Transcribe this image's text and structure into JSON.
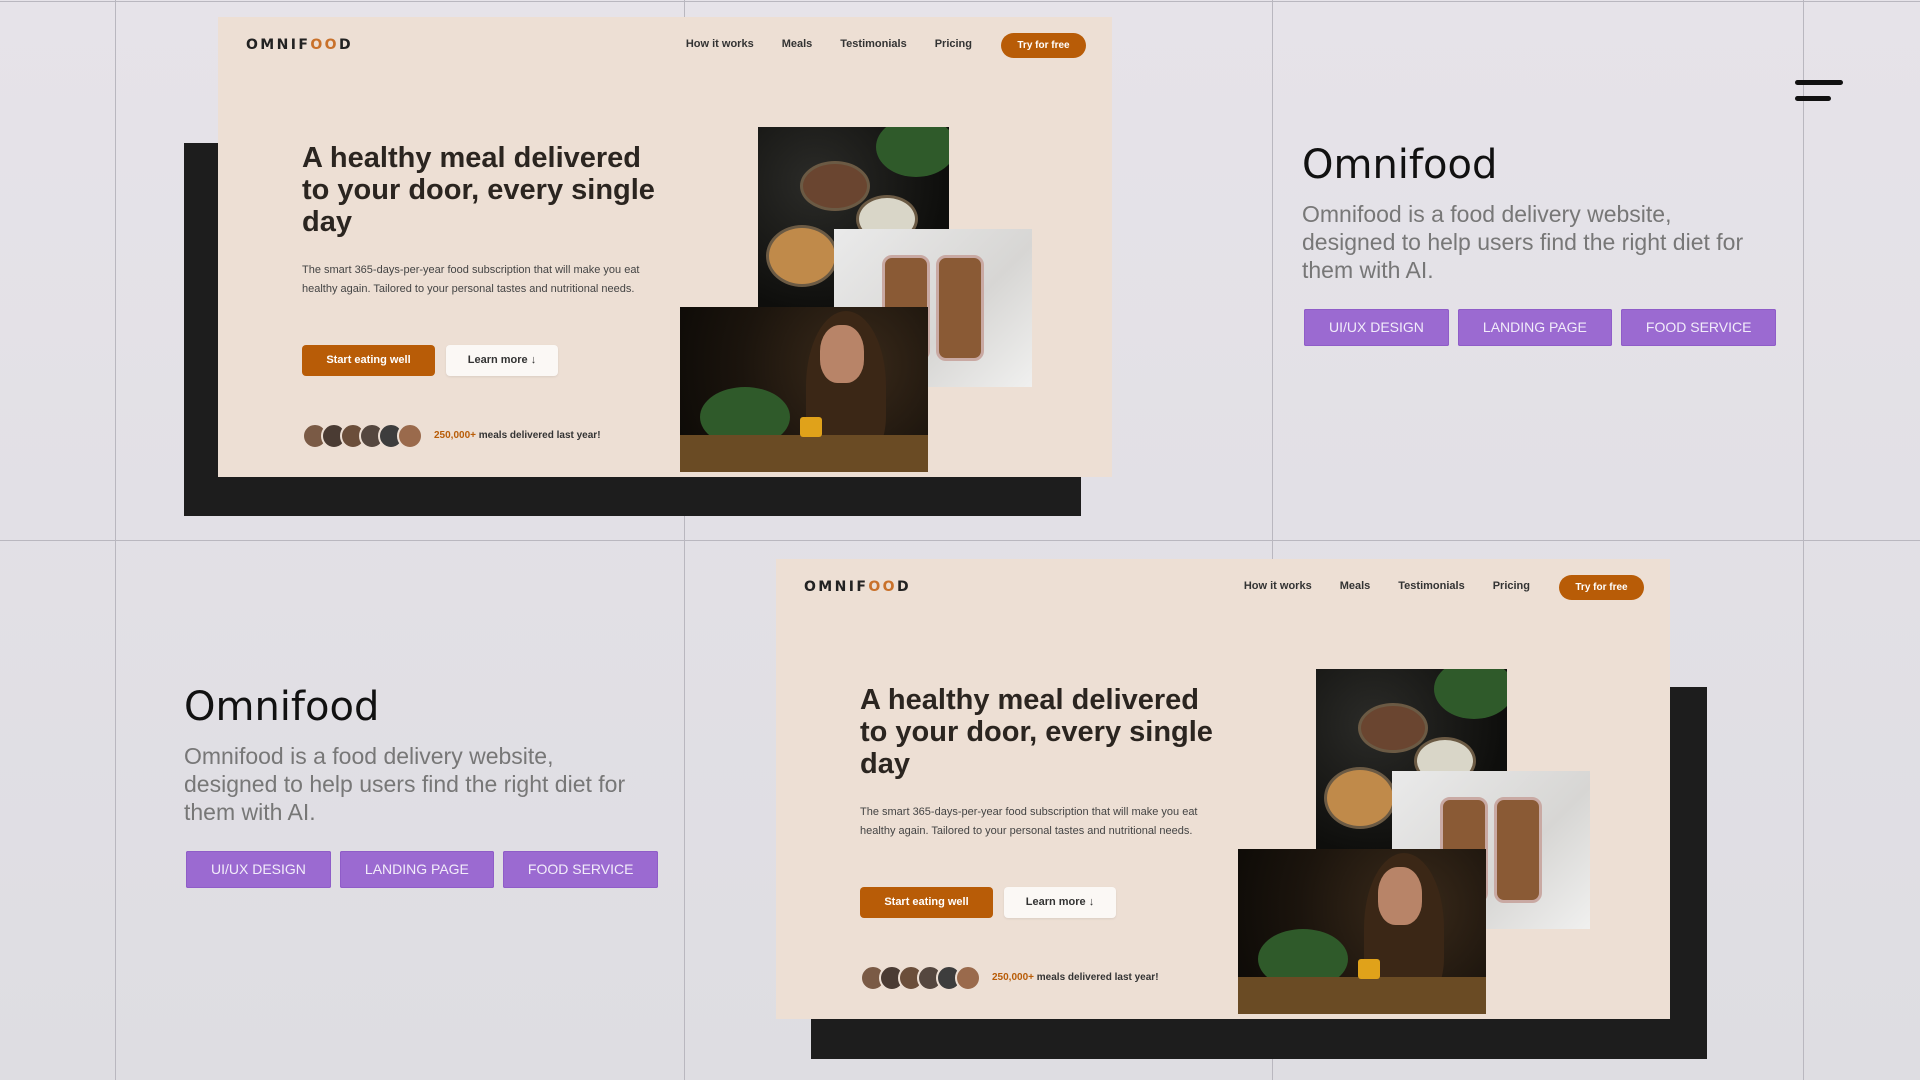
{
  "grid": {
    "color": "#b9b7bf"
  },
  "menu": {
    "icon": "hamburger-icon"
  },
  "mockups": [
    {
      "logo": {
        "pre": "OMNIF",
        "oo": "OO",
        "post": "D"
      },
      "nav": [
        "How it works",
        "Meals",
        "Testimonials",
        "Pricing"
      ],
      "try_button": "Try for free",
      "hero": {
        "title": "A healthy meal delivered to your door, every single day",
        "description": "The smart 365-days-per-year food subscription that will make you eat healthy again. Tailored to your personal tastes and nutritional needs.",
        "primary_cta": "Start eating well",
        "secondary_cta": "Learn more ↓",
        "delivered_count": "250,000+",
        "delivered_text": "meals delivered last year!"
      }
    },
    {
      "logo": {
        "pre": "OMNIF",
        "oo": "OO",
        "post": "D"
      },
      "nav": [
        "How it works",
        "Meals",
        "Testimonials",
        "Pricing"
      ],
      "try_button": "Try for free",
      "hero": {
        "title": "A healthy meal delivered to your door, every single day",
        "description": "The smart 365-days-per-year food subscription that will make you eat healthy again. Tailored to your personal tastes and nutritional needs.",
        "primary_cta": "Start eating well",
        "secondary_cta": "Learn more ↓",
        "delivered_count": "250,000+",
        "delivered_text": "meals delivered last year!"
      }
    }
  ],
  "info_blocks": [
    {
      "title": "Omnifood",
      "description": "Omnifood is a food delivery website, designed to help users find the right diet for them with AI.",
      "tags": [
        "UI/UX DESIGN",
        "LANDING PAGE",
        "FOOD SERVICE"
      ]
    },
    {
      "title": "Omnifood",
      "description": "Omnifood is a food delivery website, designed to help users find the right diet for them with AI.",
      "tags": [
        "UI/UX DESIGN",
        "LANDING PAGE",
        "FOOD SERVICE"
      ]
    }
  ],
  "colors": {
    "accent": "#b85c07",
    "tag": "#9b6ad1",
    "mockup_bg": "#eddfd4"
  }
}
